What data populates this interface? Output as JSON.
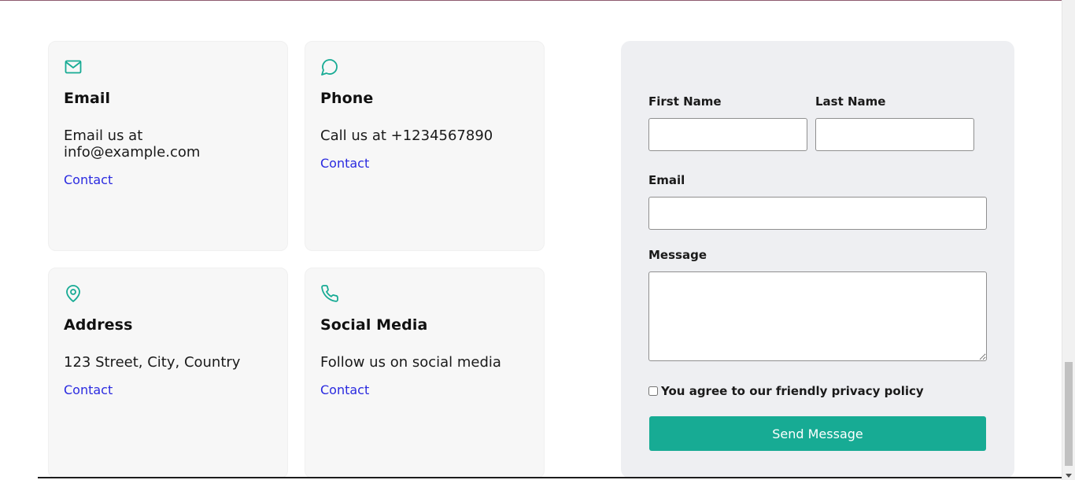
{
  "cards": [
    {
      "icon": "mail-icon",
      "title": "Email",
      "text": "Email us at info@example.com",
      "link": "Contact"
    },
    {
      "icon": "chat-bubble-icon",
      "title": "Phone",
      "text": "Call us at +1234567890",
      "link": "Contact"
    },
    {
      "icon": "map-pin-icon",
      "title": "Address",
      "text": "123 Street, City, Country",
      "link": "Contact"
    },
    {
      "icon": "phone-icon",
      "title": "Social Media",
      "text": "Follow us on social media",
      "link": "Contact"
    }
  ],
  "form": {
    "first_name_label": "First Name",
    "first_name_value": "",
    "last_name_label": "Last Name",
    "last_name_value": "",
    "email_label": "Email",
    "email_value": "",
    "message_label": "Message",
    "message_value": "",
    "consent_label": "You agree to our friendly privacy policy",
    "consent_checked": false,
    "submit_label": "Send Message"
  },
  "colors": {
    "accent": "#17ab94",
    "link": "#2a2ae0",
    "card_bg": "#f7f7f7",
    "panel_bg": "#eeeff2"
  }
}
